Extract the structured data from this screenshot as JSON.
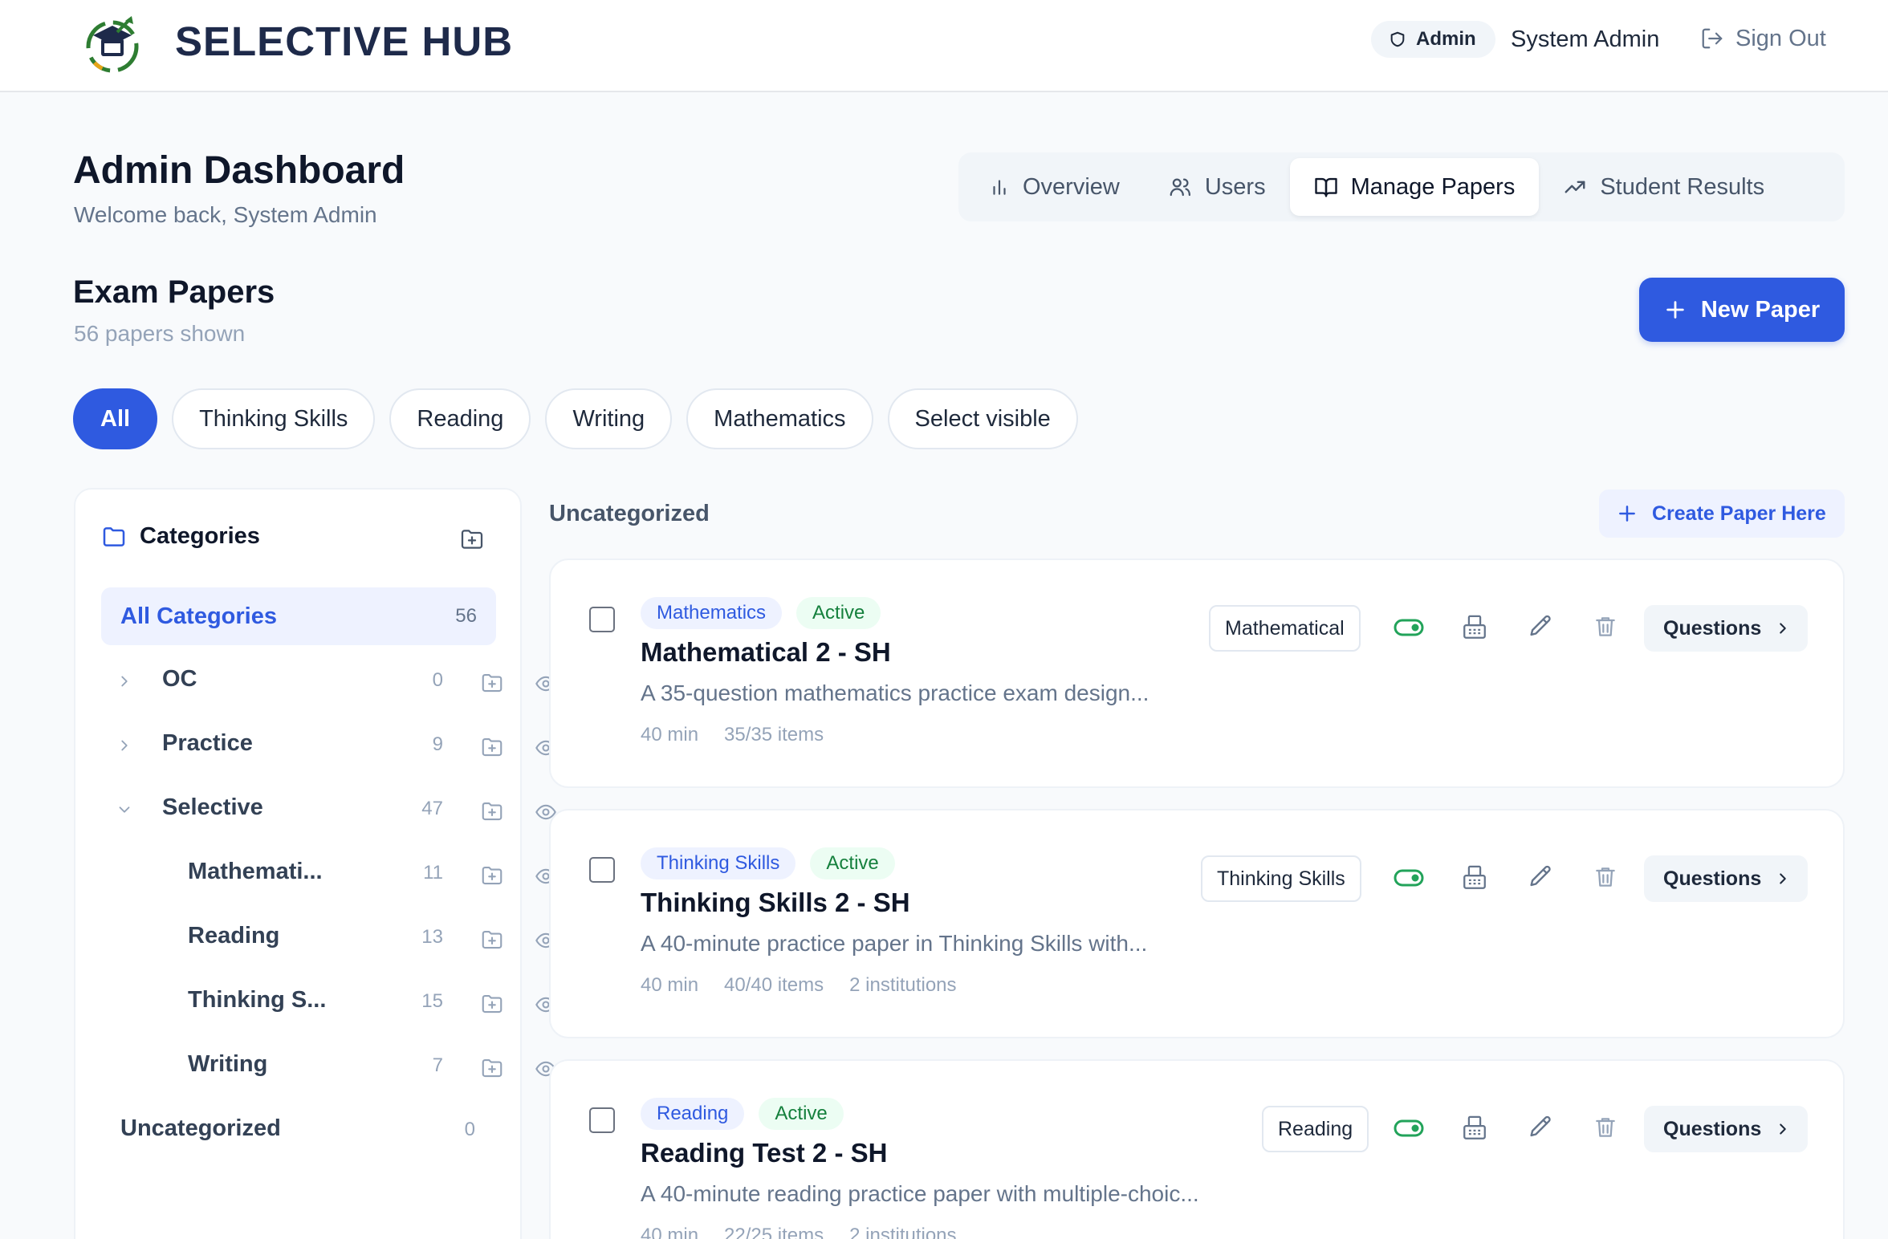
{
  "header": {
    "brand": "SELECTIVE HUB",
    "role_badge": "Admin",
    "user_name": "System Admin",
    "sign_out": "Sign Out"
  },
  "page": {
    "title": "Admin Dashboard",
    "subtitle": "Welcome back, System Admin"
  },
  "tabs": [
    {
      "label": "Overview",
      "icon": "bar-chart-icon"
    },
    {
      "label": "Users",
      "icon": "users-icon"
    },
    {
      "label": "Manage Papers",
      "icon": "book-open-icon",
      "active": true
    },
    {
      "label": "Student Results",
      "icon": "trending-up-icon"
    }
  ],
  "papers_section": {
    "title": "Exam Papers",
    "count_text": "56 papers shown",
    "new_button": "New Paper"
  },
  "filters": [
    "All",
    "Thinking Skills",
    "Reading",
    "Writing",
    "Mathematics",
    "Select visible"
  ],
  "sidebar": {
    "title": "Categories",
    "all_label": "All Categories",
    "all_count": "56",
    "items": [
      {
        "label": "OC",
        "count": "0"
      },
      {
        "label": "Practice",
        "count": "9"
      },
      {
        "label": "Selective",
        "count": "47"
      },
      {
        "label": "Mathemati...",
        "count": "11"
      },
      {
        "label": "Reading",
        "count": "13"
      },
      {
        "label": "Thinking S...",
        "count": "15"
      },
      {
        "label": "Writing",
        "count": "7"
      },
      {
        "label": "Uncategorized",
        "count": "0"
      }
    ]
  },
  "group": {
    "title": "Uncategorized",
    "create_button": "Create Paper Here"
  },
  "cards": [
    {
      "subject": "Mathematics",
      "status": "Active",
      "title": "Mathematical 2 - SH",
      "description": "A 35-question mathematics practice exam design...",
      "duration": "40 min",
      "items": "35/35 items",
      "institutions": "",
      "category": "Mathematical",
      "questions_label": "Questions"
    },
    {
      "subject": "Thinking Skills",
      "status": "Active",
      "title": "Thinking Skills 2 - SH",
      "description": "A 40-minute practice paper in Thinking Skills with...",
      "duration": "40 min",
      "items": "40/40 items",
      "institutions": "2 institutions",
      "category": "Thinking Skills",
      "questions_label": "Questions"
    },
    {
      "subject": "Reading",
      "status": "Active",
      "title": "Reading Test 2 - SH",
      "description": "A 40-minute reading practice paper with multiple-choic...",
      "duration": "40 min",
      "items": "22/25 items",
      "institutions": "2 institutions",
      "category": "Reading",
      "questions_label": "Questions"
    }
  ],
  "colors": {
    "accent": "#2f5ae0",
    "active_green": "#15803d",
    "toggle_green": "#22a35a"
  }
}
